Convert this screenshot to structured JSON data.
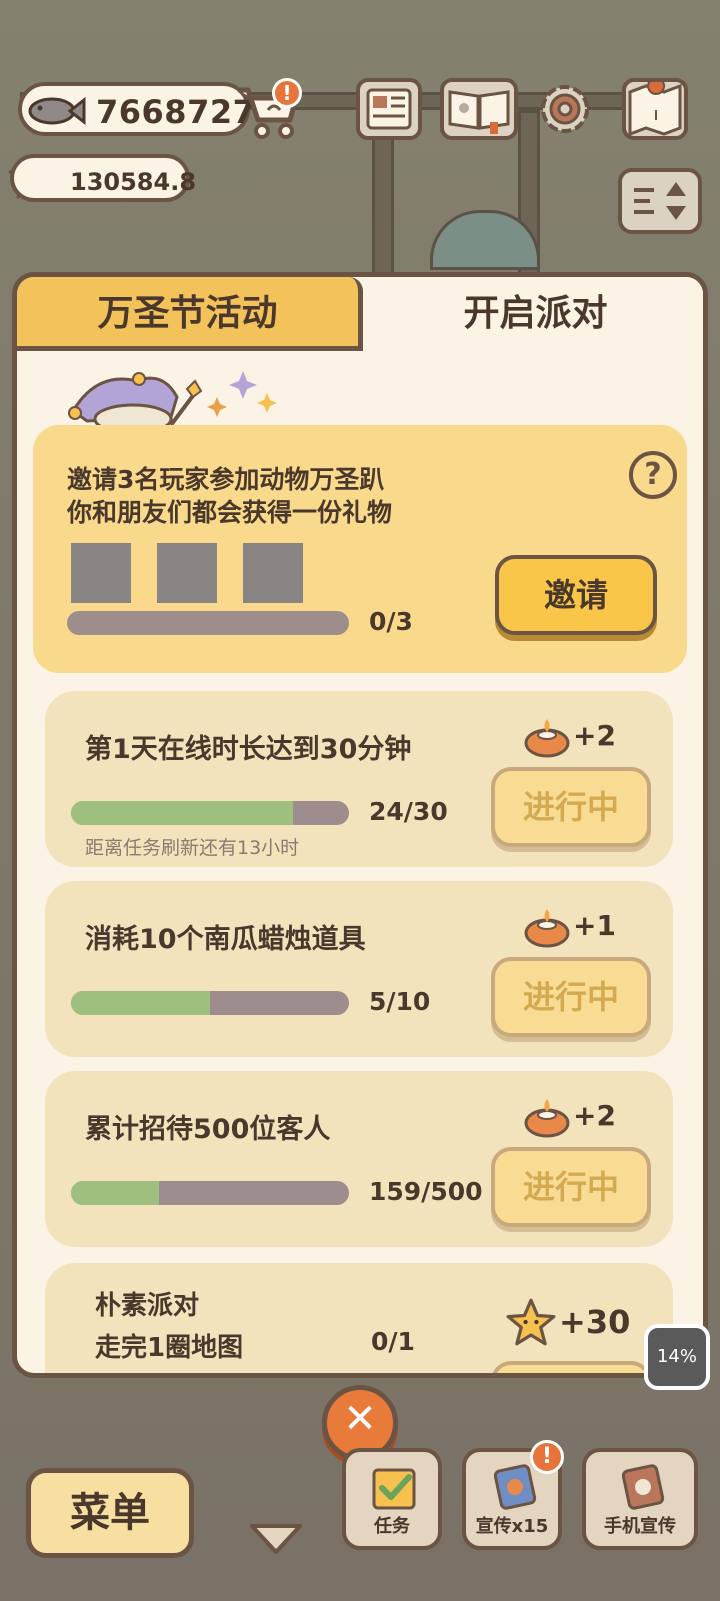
{
  "hud": {
    "fish_value": "7668727",
    "star_value": "130584.8",
    "cart_alert": "!"
  },
  "tabs": [
    {
      "label": "万圣节活动"
    },
    {
      "label": "开启派对"
    }
  ],
  "invite": {
    "line1": "邀请3名玩家参加动物万圣趴",
    "line2": "你和朋友们都会获得一份礼物",
    "help": "?",
    "progress_text": "0/3",
    "progress_fraction": 0,
    "button_label": "邀请"
  },
  "tasks": [
    {
      "title": "第1天在线时长达到30分钟",
      "reward": "+2",
      "progress_text": "24/30",
      "progress_fraction": 0.8,
      "button_label": "进行中",
      "refresh_note": "距离任务刷新还有13小时"
    },
    {
      "title": "消耗10个南瓜蜡烛道具",
      "reward": "+1",
      "progress_text": "5/10",
      "progress_fraction": 0.5,
      "button_label": "进行中"
    },
    {
      "title": "累计招待500位客人",
      "reward": "+2",
      "progress_text": "159/500",
      "progress_fraction": 0.318,
      "button_label": "进行中"
    }
  ],
  "party_task": {
    "line1": "朴素派对",
    "line2": "走完1圈地图",
    "progress_text": "0/1",
    "reward": "+30"
  },
  "bottom": {
    "close": "✕",
    "menu_label": "菜单",
    "task_label": "任务",
    "promo_label": "宣传x15",
    "promo_alert": "!",
    "phone_promo_label": "手机宣传",
    "battery_text": "14%"
  },
  "colors": {
    "accent_yellow": "#f3c25b",
    "card_yellow": "#f9d98b",
    "progress_green": "#9ebf7e",
    "border_brown": "#6b5444"
  }
}
